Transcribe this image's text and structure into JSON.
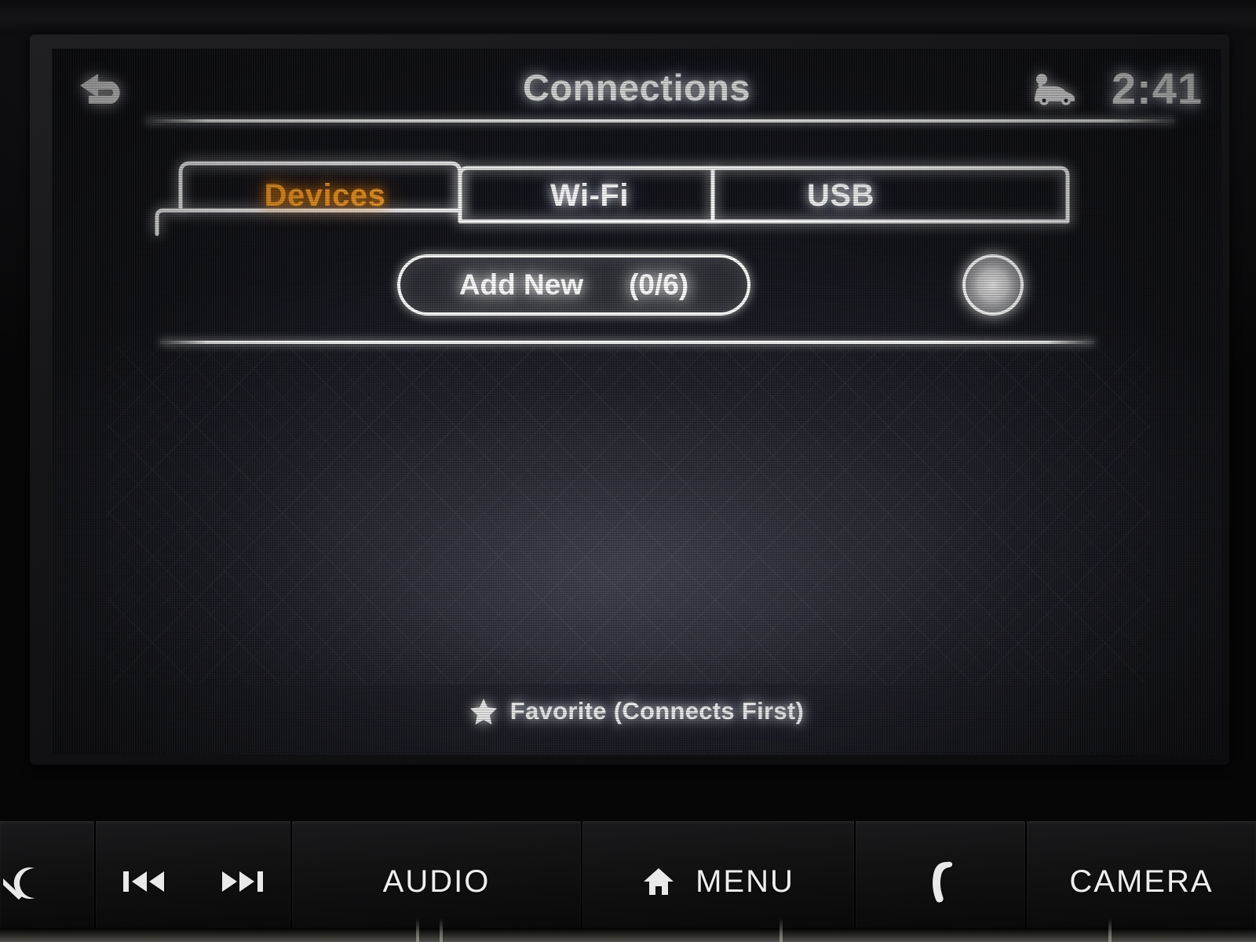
{
  "statusbar": {
    "back_icon": "back-arrow-icon",
    "title": "Connections",
    "vehicle_icon": "car-status-icon",
    "clock": "2:41"
  },
  "tabs": [
    {
      "id": "devices",
      "label": "Devices",
      "active": true
    },
    {
      "id": "wifi",
      "label": "Wi-Fi",
      "active": false
    },
    {
      "id": "usb",
      "label": "USB",
      "active": false
    }
  ],
  "actions": {
    "add_new_label": "Add New",
    "add_new_count": "(0/6)",
    "info_icon": "info-button-icon"
  },
  "device_list": {
    "items": [],
    "empty": true
  },
  "footer": {
    "star_icon": "star-icon",
    "legend": "Favorite (Connects First)"
  },
  "hardware_buttons": [
    {
      "id": "power",
      "label": "",
      "icon": "power-volume-knob-icon"
    },
    {
      "id": "track",
      "label": "",
      "icon": "prev-next-track-icon"
    },
    {
      "id": "audio",
      "label": "AUDIO",
      "icon": ""
    },
    {
      "id": "menu",
      "label": "MENU",
      "icon": "home-icon"
    },
    {
      "id": "phone",
      "label": "",
      "icon": "phone-handset-icon"
    },
    {
      "id": "camera",
      "label": "CAMERA",
      "icon": ""
    }
  ],
  "colors": {
    "active_tab": "#ff9e1b",
    "text": "#ffffff",
    "screen_bg": "#23242c",
    "bezel": "#141416"
  }
}
